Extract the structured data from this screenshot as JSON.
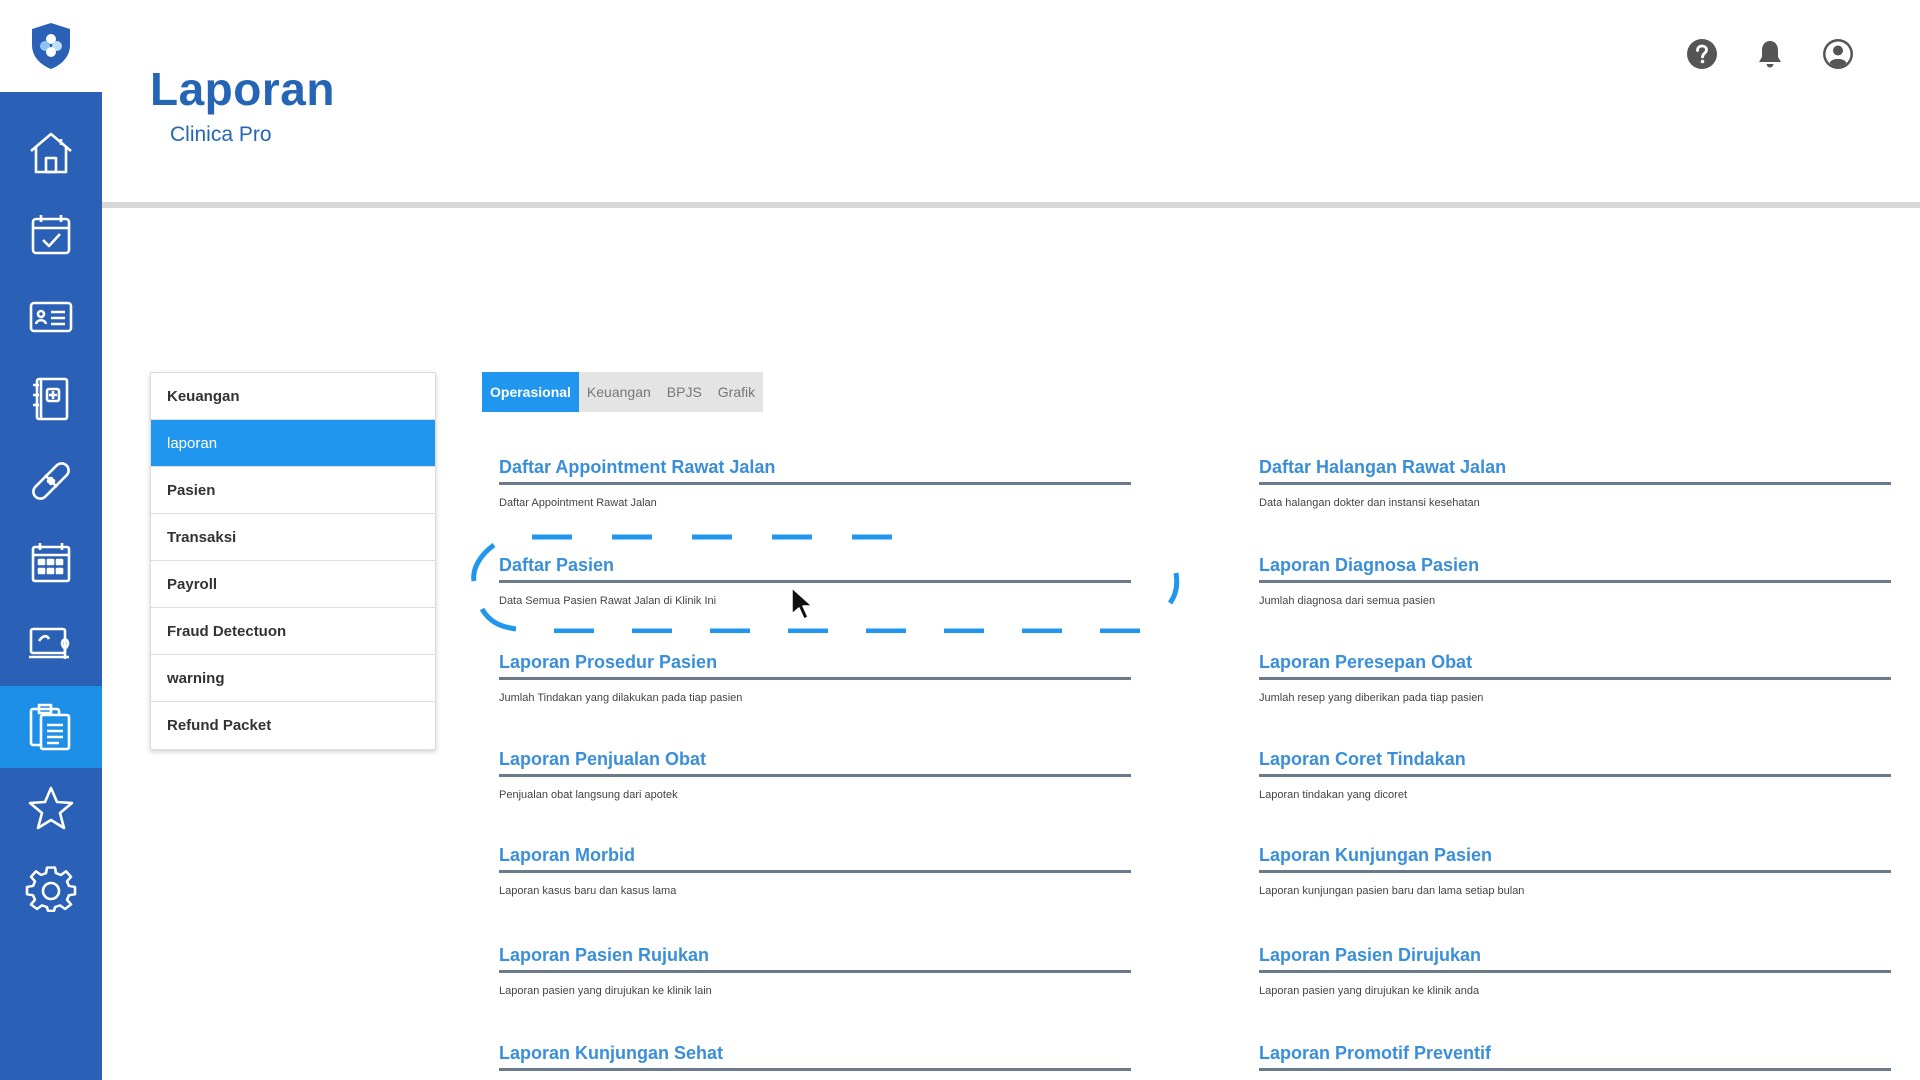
{
  "header": {
    "title": "Laporan",
    "subtitle": "Clinica Pro"
  },
  "rail": {
    "logo_icon": "shield-cross-logo",
    "items": [
      {
        "icon": "home-icon",
        "active": false
      },
      {
        "icon": "calendar-check-icon",
        "active": false
      },
      {
        "icon": "id-card-icon",
        "active": false
      },
      {
        "icon": "medical-book-icon",
        "active": false
      },
      {
        "icon": "bandage-icon",
        "active": false
      },
      {
        "icon": "building-icon",
        "active": false
      },
      {
        "icon": "computer-plant-icon",
        "active": false
      },
      {
        "icon": "clipboard-copy-icon",
        "active": true
      },
      {
        "icon": "star-icon",
        "active": false
      },
      {
        "icon": "gear-icon",
        "active": false
      }
    ]
  },
  "header_icons": [
    "help-icon",
    "bell-icon",
    "user-icon"
  ],
  "side_menu": {
    "items": [
      {
        "label": "Keuangan",
        "active": false
      },
      {
        "label": "laporan",
        "active": true
      },
      {
        "label": "Pasien",
        "active": false
      },
      {
        "label": "Transaksi",
        "active": false
      },
      {
        "label": "Payroll",
        "active": false
      },
      {
        "label": "Fraud Detectuon",
        "active": false
      },
      {
        "label": "warning",
        "active": false
      },
      {
        "label": "Refund Packet",
        "active": false
      }
    ]
  },
  "tabs": [
    {
      "label": "Operasional",
      "active": true
    },
    {
      "label": "Keuangan",
      "active": false
    },
    {
      "label": "BPJS",
      "active": false
    },
    {
      "label": "Grafik",
      "active": false
    }
  ],
  "reports": {
    "left": [
      {
        "title": "Daftar Appointment Rawat Jalan",
        "desc": "Daftar Appointment Rawat Jalan"
      },
      {
        "title": "Daftar Pasien",
        "desc": "Data Semua Pasien Rawat Jalan di Klinik Ini"
      },
      {
        "title": "Laporan Prosedur Pasien",
        "desc": "Jumlah Tindakan yang dilakukan pada tiap pasien"
      },
      {
        "title": "Laporan Penjualan Obat",
        "desc": "Penjualan obat langsung dari apotek"
      },
      {
        "title": "Laporan Morbid",
        "desc": "Laporan kasus baru dan kasus lama"
      },
      {
        "title": "Laporan Pasien Rujukan",
        "desc": "Laporan pasien yang dirujukan ke klinik lain"
      },
      {
        "title": "Laporan Kunjungan Sehat",
        "desc": ""
      }
    ],
    "right": [
      {
        "title": "Daftar Halangan Rawat Jalan",
        "desc": "Data halangan dokter dan instansi kesehatan"
      },
      {
        "title": "Laporan Diagnosa Pasien",
        "desc": "Jumlah diagnosa dari semua pasien"
      },
      {
        "title": "Laporan Peresepan Obat",
        "desc": "Jumlah resep yang diberikan pada tiap pasien"
      },
      {
        "title": "Laporan Coret Tindakan",
        "desc": "Laporan tindakan yang dicoret"
      },
      {
        "title": "Laporan Kunjungan Pasien",
        "desc": "Laporan kunjungan pasien baru dan lama setiap bulan"
      },
      {
        "title": "Laporan Pasien Dirujukan",
        "desc": "Laporan pasien yang dirujukan ke klinik anda"
      },
      {
        "title": "Laporan Promotif Preventif",
        "desc": ""
      }
    ]
  },
  "colors": {
    "rail_blue": "#2a60b6",
    "active_blue": "#1e8fe6",
    "title_blue": "#2565b5",
    "link_blue": "#3a8fd8"
  }
}
